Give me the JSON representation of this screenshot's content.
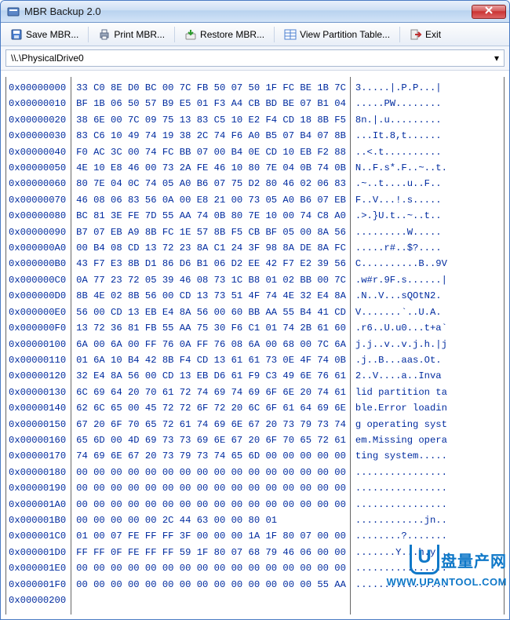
{
  "window": {
    "title": "MBR Backup 2.0"
  },
  "toolbar": {
    "save": "Save MBR...",
    "print": "Print MBR...",
    "restore": "Restore MBR...",
    "view": "View Partition Table...",
    "exit": "Exit"
  },
  "drive": {
    "selected": "\\\\.\\PhysicalDrive0",
    "chevron": "▾"
  },
  "hex": {
    "offsets": [
      "0x00000000",
      "0x00000010",
      "0x00000020",
      "0x00000030",
      "0x00000040",
      "0x00000050",
      "0x00000060",
      "0x00000070",
      "0x00000080",
      "0x00000090",
      "0x000000A0",
      "0x000000B0",
      "0x000000C0",
      "0x000000D0",
      "0x000000E0",
      "0x000000F0",
      "0x00000100",
      "0x00000110",
      "0x00000120",
      "0x00000130",
      "0x00000140",
      "0x00000150",
      "0x00000160",
      "0x00000170",
      "0x00000180",
      "0x00000190",
      "0x000001A0",
      "0x000001B0",
      "0x000001C0",
      "0x000001D0",
      "0x000001E0",
      "0x000001F0",
      "0x00000200"
    ],
    "bytes": [
      "33 C0 8E D0 BC 00 7C FB 50 07 50 1F FC BE 1B 7C",
      "BF 1B 06 50 57 B9 E5 01 F3 A4 CB BD BE 07 B1 04",
      "38 6E 00 7C 09 75 13 83 C5 10 E2 F4 CD 18 8B F5",
      "83 C6 10 49 74 19 38 2C 74 F6 A0 B5 07 B4 07 8B",
      "F0 AC 3C 00 74 FC BB 07 00 B4 0E CD 10 EB F2 88",
      "4E 10 E8 46 00 73 2A FE 46 10 80 7E 04 0B 74 0B",
      "80 7E 04 0C 74 05 A0 B6 07 75 D2 80 46 02 06 83",
      "46 08 06 83 56 0A 00 E8 21 00 73 05 A0 B6 07 EB",
      "BC 81 3E FE 7D 55 AA 74 0B 80 7E 10 00 74 C8 A0",
      "B7 07 EB A9 8B FC 1E 57 8B F5 CB BF 05 00 8A 56",
      "00 B4 08 CD 13 72 23 8A C1 24 3F 98 8A DE 8A FC",
      "43 F7 E3 8B D1 86 D6 B1 06 D2 EE 42 F7 E2 39 56",
      "0A 77 23 72 05 39 46 08 73 1C B8 01 02 BB 00 7C",
      "8B 4E 02 8B 56 00 CD 13 73 51 4F 74 4E 32 E4 8A",
      "56 00 CD 13 EB E4 8A 56 00 60 BB AA 55 B4 41 CD",
      "13 72 36 81 FB 55 AA 75 30 F6 C1 01 74 2B 61 60",
      "6A 00 6A 00 FF 76 0A FF 76 08 6A 00 68 00 7C 6A",
      "01 6A 10 B4 42 8B F4 CD 13 61 61 73 0E 4F 74 0B",
      "32 E4 8A 56 00 CD 13 EB D6 61 F9 C3 49 6E 76 61",
      "6C 69 64 20 70 61 72 74 69 74 69 6F 6E 20 74 61",
      "62 6C 65 00 45 72 72 6F 72 20 6C 6F 61 64 69 6E",
      "67 20 6F 70 65 72 61 74 69 6E 67 20 73 79 73 74",
      "65 6D 00 4D 69 73 73 69 6E 67 20 6F 70 65 72 61",
      "74 69 6E 67 20 73 79 73 74 65 6D 00 00 00 00 00",
      "00 00 00 00 00 00 00 00 00 00 00 00 00 00 00 00",
      "00 00 00 00 00 00 00 00 00 00 00 00 00 00 00 00",
      "00 00 00 00 00 00 00 00 00 00 00 00 00 00 00 00",
      "00 00 00 00 00 2C 44 63 00 00 80 01",
      "01 00 07 FE FF FF 3F 00 00 00 1A 1F 80 07 00 00",
      "FF FF 0F FE FF FF 59 1F 80 07 68 79 46 06 00 00",
      "00 00 00 00 00 00 00 00 00 00 00 00 00 00 00 00",
      "00 00 00 00 00 00 00 00 00 00 00 00 00 00 55 AA",
      ""
    ],
    "ascii": [
      "3.....|.P.P...|",
      ".....PW........",
      "8n.|.u.........",
      "...It.8,t......",
      "..<.t..........",
      "N..F.s*.F..~..t.",
      ".~..t....u..F..",
      "F..V...!.s.....",
      ".>.}U.t..~..t..",
      ".........W.....",
      ".....r#..$?....",
      "C..........B..9V",
      ".w#r.9F.s......|",
      ".N..V...sQOtN2.",
      "V.......`..U.A.",
      ".r6..U.u0...t+a`",
      "j.j..v..v.j.h.|j",
      ".j..B...aas.Ot.",
      "2..V....a..Inva",
      "lid partition ta",
      "ble.Error loadin",
      "g operating syst",
      "em.Missing opera",
      "ting system.....",
      "................",
      "................",
      "................",
      "............jn..",
      "........?.......",
      ".......Y...h.y..",
      "................",
      "................",
      ""
    ]
  },
  "watermark": {
    "badge_u": "U",
    "text": "盘量产网",
    "url": "WWW.UPANTOOL.COM"
  }
}
